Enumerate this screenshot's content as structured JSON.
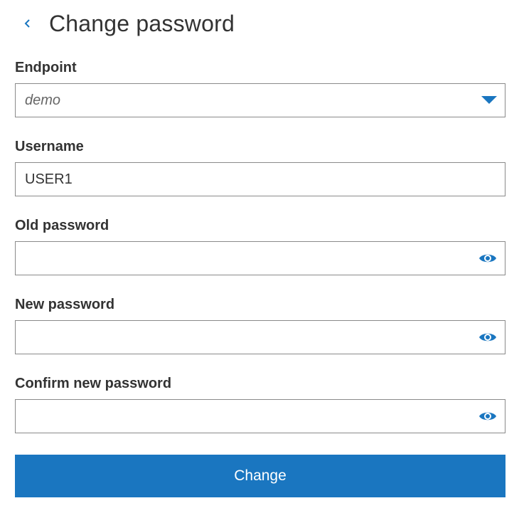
{
  "header": {
    "title": "Change password",
    "back_icon": "chevron-left-icon"
  },
  "form": {
    "endpoint": {
      "label": "Endpoint",
      "selected": "demo",
      "icon": "caret-down-icon"
    },
    "username": {
      "label": "Username",
      "value": "USER1"
    },
    "old_password": {
      "label": "Old password",
      "value": "",
      "icon": "eye-icon"
    },
    "new_password": {
      "label": "New password",
      "value": "",
      "icon": "eye-icon"
    },
    "confirm_password": {
      "label": "Confirm new password",
      "value": "",
      "icon": "eye-icon"
    },
    "submit_label": "Change"
  },
  "colors": {
    "accent": "#1a76c0",
    "text": "#333333",
    "border": "#8a8a8a"
  }
}
